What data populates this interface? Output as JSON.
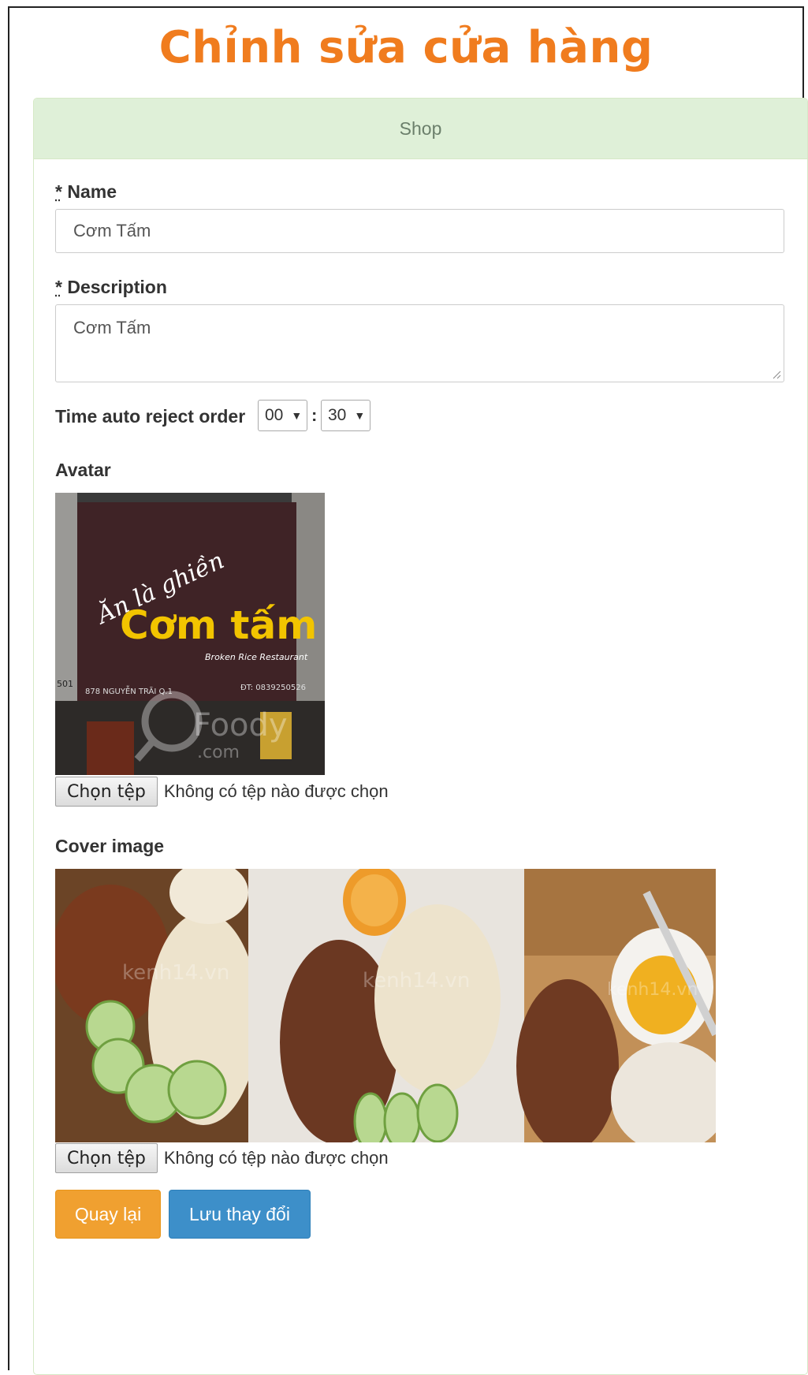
{
  "page": {
    "title": "Chỉnh sửa cửa hàng"
  },
  "panel": {
    "heading": "Shop"
  },
  "form": {
    "name": {
      "label": "Name",
      "required_mark": "*",
      "value": "Cơm Tấm"
    },
    "description": {
      "label": "Description",
      "required_mark": "*",
      "value": "Cơm Tấm"
    },
    "auto_reject": {
      "label": "Time auto reject order",
      "hours": "00",
      "minutes": "30",
      "separator": ":"
    },
    "avatar": {
      "label": "Avatar",
      "sign_script": "Ăn là ghiền",
      "sign_main": "Cơm tấm",
      "sign_sub": "Broken Rice Restaurant",
      "sign_addr": "878 NGUYỄN TRÃI Q.1",
      "sign_phone": "ĐT: 0839250526",
      "sign_number": "501",
      "watermark": "Foody",
      "watermark_sub": ".com",
      "file_button": "Chọn tệp",
      "file_status": "Không có tệp nào được chọn"
    },
    "cover": {
      "label": "Cover image",
      "watermark": "kenh14.vn",
      "file_button": "Chọn tệp",
      "file_status": "Không có tệp nào được chọn"
    },
    "buttons": {
      "back": "Quay lại",
      "save": "Lưu thay đổi"
    }
  },
  "colors": {
    "title": "#f07c1e",
    "panel_heading_bg": "#dff0d8",
    "back_button": "#f0a030",
    "save_button": "#3d8fc9",
    "sign_yellow": "#f2c400"
  }
}
